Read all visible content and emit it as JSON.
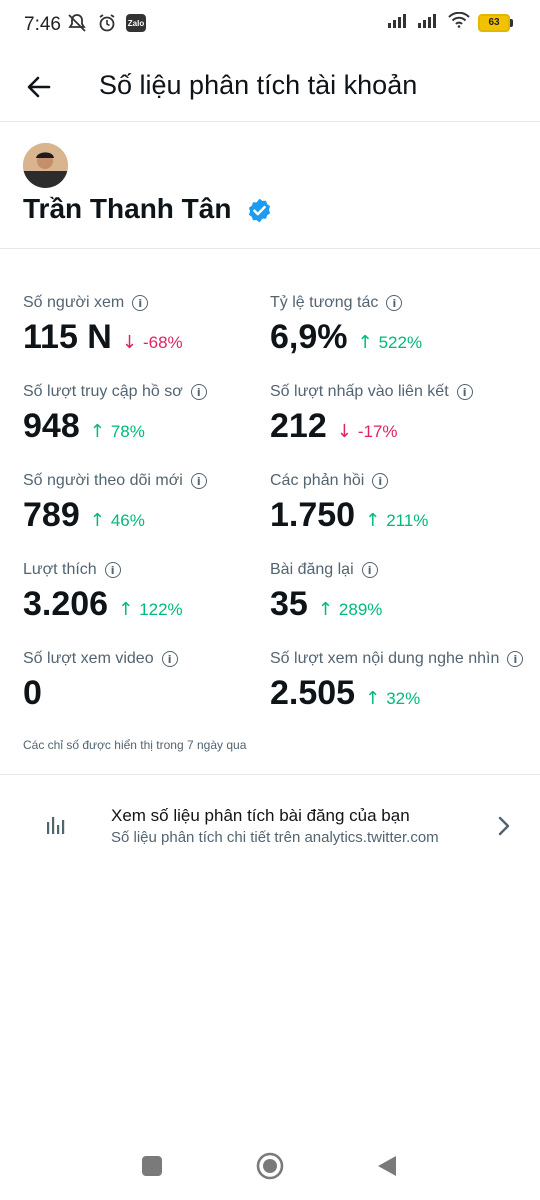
{
  "status_bar": {
    "time": "7:46",
    "zalo": "Zalo",
    "battery": "63"
  },
  "header": {
    "title": "Số liệu phân tích tài khoản"
  },
  "profile": {
    "name": "Trần Thanh Tân"
  },
  "metrics": [
    {
      "label": "Số người xem",
      "value": "115 N",
      "change": "-68%",
      "direction": "down"
    },
    {
      "label": "Tỷ lệ tương tác",
      "value": "6,9%",
      "change": "522%",
      "direction": "up"
    },
    {
      "label": "Số lượt truy cập hồ sơ",
      "value": "948",
      "change": "78%",
      "direction": "up"
    },
    {
      "label": "Số lượt nhấp vào liên kết",
      "value": "212",
      "change": "-17%",
      "direction": "down"
    },
    {
      "label": "Số người theo dõi mới",
      "value": "789",
      "change": "46%",
      "direction": "up"
    },
    {
      "label": "Các phản hồi",
      "value": "1.750",
      "change": "211%",
      "direction": "up"
    },
    {
      "label": "Lượt thích",
      "value": "3.206",
      "change": "122%",
      "direction": "up"
    },
    {
      "label": "Bài đăng lại",
      "value": "35",
      "change": "289%",
      "direction": "up"
    },
    {
      "label": "Số lượt xem video",
      "value": "0",
      "change": "",
      "direction": "none"
    },
    {
      "label": "Số lượt xem nội dung nghe nhìn",
      "value": "2.505",
      "change": "32%",
      "direction": "up"
    }
  ],
  "footnote": "Các chỉ số được hiển thị trong 7 ngày qua",
  "analytics_link": {
    "title": "Xem số liệu phân tích bài đăng của bạn",
    "subtitle": "Số liệu phân tích chi tiết trên analytics.twitter.com"
  },
  "colors": {
    "up": "#00ba7c",
    "down": "#e0245e",
    "verified": "#1d9bf0"
  },
  "icons": {
    "up_arrow": "↑",
    "down_arrow": "↓",
    "info": "i"
  }
}
